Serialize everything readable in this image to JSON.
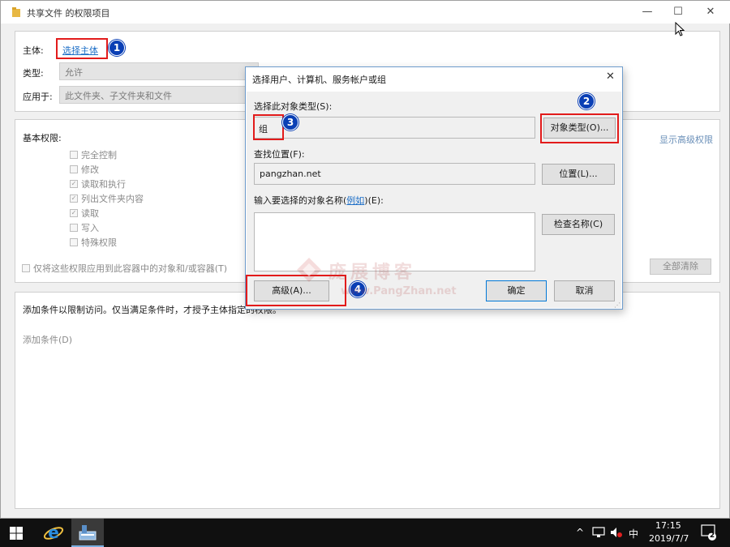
{
  "window": {
    "title": "共享文件 的权限项目",
    "controls": {
      "minimize": "—",
      "maximize": "☐",
      "close": "✕"
    }
  },
  "principal": {
    "label": "主体:",
    "value": "选择主体"
  },
  "type": {
    "label": "类型:",
    "value": "允许"
  },
  "applies_to": {
    "label": "应用于:",
    "value": "此文件夹、子文件夹和文件"
  },
  "basic_permissions": {
    "heading": "基本权限:",
    "items": [
      {
        "label": "完全控制",
        "checked": false
      },
      {
        "label": "修改",
        "checked": false
      },
      {
        "label": "读取和执行",
        "checked": true
      },
      {
        "label": "列出文件夹内容",
        "checked": true
      },
      {
        "label": "读取",
        "checked": true
      },
      {
        "label": "写入",
        "checked": false
      },
      {
        "label": "特殊权限",
        "checked": false
      }
    ],
    "apply_inherit_label": "仅将这些权限应用到此容器中的对象和/或容器(T)",
    "show_advanced": "显示高级权限",
    "clear_all": "全部清除"
  },
  "conditions": {
    "text": "添加条件以限制访问。仅当满足条件时，才授予主体指定的权限。",
    "add_condition": "添加条件(D)"
  },
  "dialog": {
    "title": "选择用户、计算机、服务帐户或组",
    "close": "✕",
    "object_types_label": "选择此对象类型(S):",
    "object_types_value": "组",
    "object_types_button": "对象类型(O)...",
    "location_label": "查找位置(F):",
    "location_value": "pangzhan.net",
    "location_button": "位置(L)...",
    "names_label_prefix": "输入要选择的对象名称(",
    "names_label_link": "例如",
    "names_label_suffix": ")(E):",
    "check_names_button": "检查名称(C)",
    "advanced_button": "高级(A)...",
    "ok_button": "确定",
    "cancel_button": "取消"
  },
  "annotations": {
    "m1": "1",
    "m2": "2",
    "m3": "3",
    "m4": "4"
  },
  "watermark": {
    "cn": "庞展博客",
    "en": "www.PangZhan.net"
  },
  "taskbar": {
    "ime": "中",
    "time": "17:15",
    "date": "2019/7/7",
    "notification_count": "2"
  },
  "colors": {
    "accent": "#0078d7",
    "annotation_red": "#e21b1b",
    "marker_blue": "#0a3fb5",
    "link": "#1e6fc7"
  }
}
